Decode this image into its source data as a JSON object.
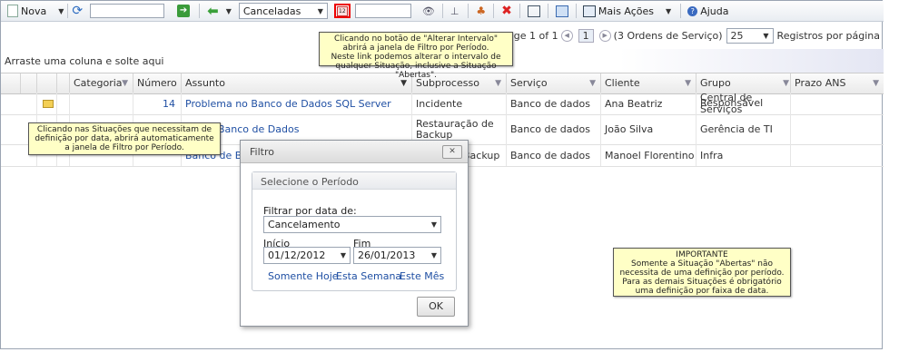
{
  "toolbar": {
    "new_label": "Nova",
    "status_filter": "Canceladas",
    "more_actions_label": "Mais Ações",
    "help_label": "Ajuda"
  },
  "pager": {
    "page_text": "Page 1 of 1",
    "page_number": "1",
    "count_text": "(3 Ordens de Serviço)",
    "page_size": "25",
    "per_page_label": "Registros por página"
  },
  "group_hint": "Arraste uma coluna e solte aqui",
  "columns": {
    "categoria": "Categoria",
    "numero": "Número",
    "assunto": "Assunto",
    "subprocesso": "Subprocesso",
    "servico": "Serviço",
    "cliente": "Cliente",
    "grupo": "Grupo Responsável",
    "prazo": "Prazo ANS"
  },
  "rows": [
    {
      "numero": "14",
      "assunto": "Problema no Banco de Dados SQL Server",
      "subprocesso": "Incidente",
      "servico": "Banco de dados",
      "cliente": "Ana Beatriz",
      "grupo": "Central de Serviços"
    },
    {
      "numero": "",
      "assunto": "Banco de Dados",
      "subprocesso": "Restauração de Backup",
      "servico": "Banco de dados",
      "cliente": "João Silva",
      "grupo": "Gerência de TI"
    },
    {
      "numero": "",
      "assunto": "Banco de B",
      "subprocesso": "Backup",
      "servico": "Banco de dados",
      "cliente": "Manoel Florentino",
      "grupo": "Infra"
    }
  ],
  "tooltips": {
    "interval": "Clicando no botão de \"Alterar Intervalo\" abrirá a janela de Filtro por Período.\nNeste link podemos alterar o intervalo de qualquer Situação, inclusive a Situação \"Abertas\".",
    "situations": "Clicando nas Situações que necessitam de definição por data, abrirá automaticamente a janela de Filtro por Período.",
    "important_title": "IMPORTANTE",
    "important_body": "Somente a Situação \"Abertas\" não necessita de uma definição por período. Para as demais Situações é obrigatório uma definição por faixa de data."
  },
  "dialog": {
    "title": "Filtro",
    "close": "✕",
    "section": "Selecione o Período",
    "filter_label": "Filtrar por data de:",
    "filter_value": "Cancelamento",
    "start_label": "Início",
    "start_value": "01/12/2012",
    "end_label": "Fim",
    "end_value": "26/01/2013",
    "today": "Somente Hoje",
    "week": "Esta Semana",
    "month": "Este Mês",
    "ok": "OK"
  }
}
